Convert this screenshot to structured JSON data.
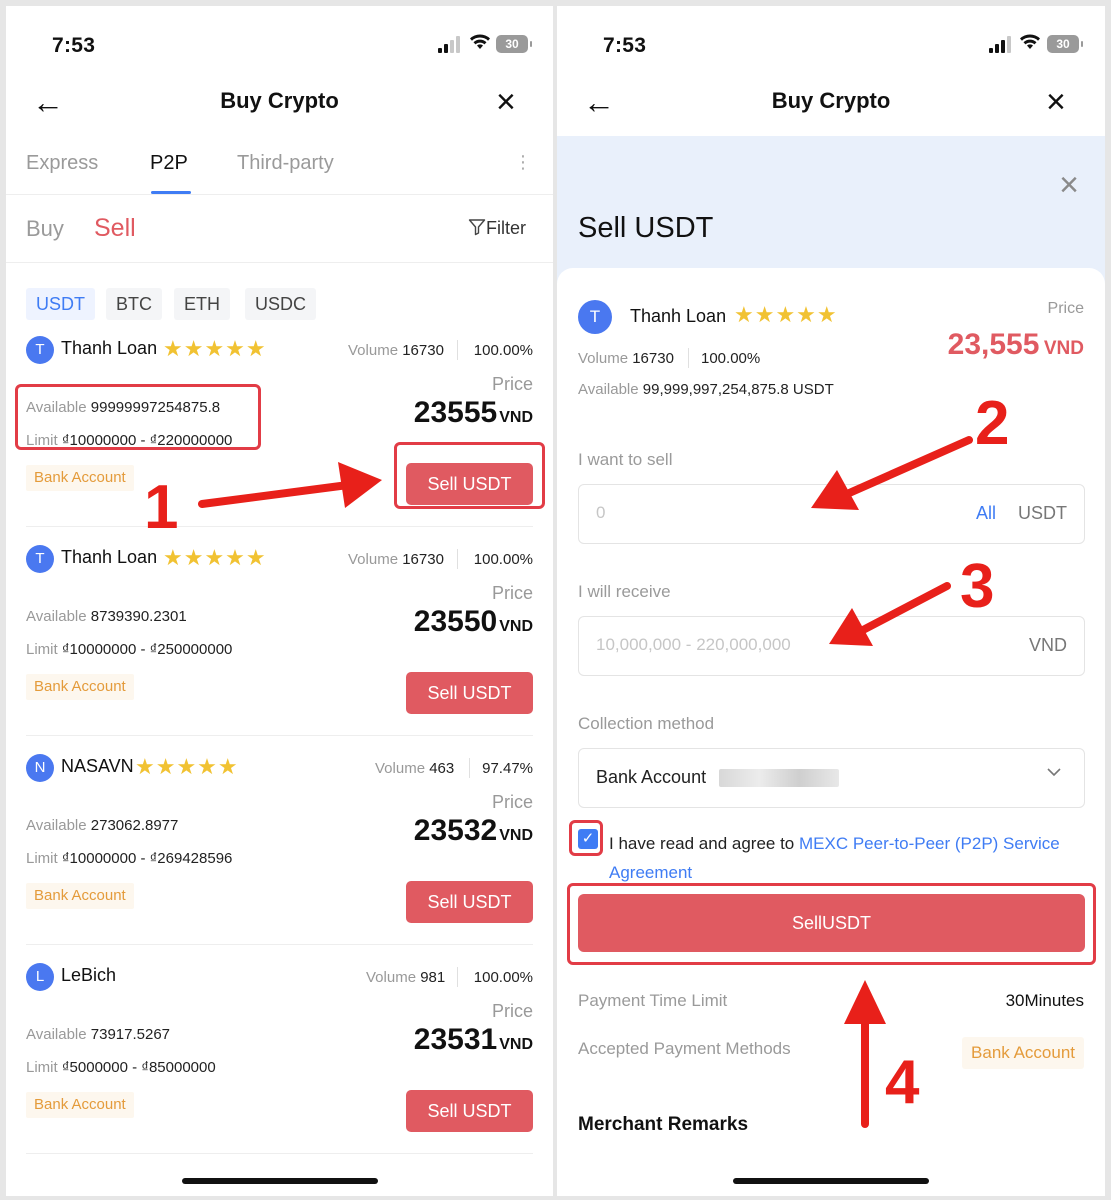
{
  "status": {
    "time": "7:53",
    "battery": "30"
  },
  "nav": {
    "title": "Buy Crypto",
    "back_glyph": "←",
    "close_glyph": "×"
  },
  "tabs": [
    {
      "label": "Express"
    },
    {
      "label": "P2P"
    },
    {
      "label": "Third-party"
    }
  ],
  "more_glyph": "⋮",
  "side": {
    "buy": "Buy",
    "sell": "Sell"
  },
  "filter": {
    "label": "Filter"
  },
  "coins": [
    "USDT",
    "BTC",
    "ETH",
    "USDC"
  ],
  "labels": {
    "volume": "Volume",
    "price": "Price",
    "available": "Available",
    "limit": "Limit",
    "currency": "VND",
    "payment_tag": "Bank Account",
    "sell_button": "Sell USDT"
  },
  "ads": [
    {
      "initial": "T",
      "merchant": "Thanh Loan",
      "stars": "★★★★★",
      "volume": "16730",
      "completion": "100.00%",
      "available": "99999997254875.8",
      "limit": "₫10000000 - ₫220000000",
      "price": "23555"
    },
    {
      "initial": "T",
      "merchant": "Thanh Loan",
      "stars": "★★★★★",
      "volume": "16730",
      "completion": "100.00%",
      "available": "8739390.2301",
      "limit": "₫10000000 - ₫250000000",
      "price": "23550"
    },
    {
      "initial": "N",
      "merchant": "NASAVN",
      "stars": "★★★★★",
      "volume": "463",
      "completion": "97.47%",
      "available": "273062.8977",
      "limit": "₫10000000 - ₫269428596",
      "price": "23532"
    },
    {
      "initial": "L",
      "merchant": "LeBich",
      "stars": "",
      "volume": "981",
      "completion": "100.00%",
      "available": "73917.5267",
      "limit": "₫5000000 - ₫85000000",
      "price": "23531"
    }
  ],
  "steps": [
    "1",
    "2",
    "3",
    "4"
  ],
  "sell_sheet": {
    "title": "Sell USDT",
    "initial": "T",
    "merchant": "Thanh Loan",
    "stars": "★★★★★",
    "price_label": "Price",
    "price": "23,555",
    "currency": "VND",
    "volume_label": "Volume",
    "volume": "16730",
    "completion": "100.00%",
    "available_label": "Available",
    "available": "99,999,997,254,875.8 USDT",
    "sell_label": "I want to sell",
    "sell_placeholder": "0",
    "all": "All",
    "sell_unit": "USDT",
    "receive_label": "I will receive",
    "receive_placeholder": "10,000,000 - 220,000,000",
    "receive_unit": "VND",
    "method_label": "Collection method",
    "method_value": "Bank Account",
    "agree_text": "I have read and agree to ",
    "agree_link": "MEXC Peer-to-Peer (P2P) Service Agreement",
    "submit": "SellUSDT",
    "time_limit_label": "Payment Time Limit",
    "time_limit": "30Minutes",
    "methods_label": "Accepted Payment Methods",
    "methods_value": "Bank Account",
    "remarks_title": "Merchant Remarks"
  },
  "colors": {
    "accent": "#3f7cf4",
    "sell_red": "#e05a61",
    "annotation": "#e8201a",
    "tag": "#e49b3b"
  }
}
